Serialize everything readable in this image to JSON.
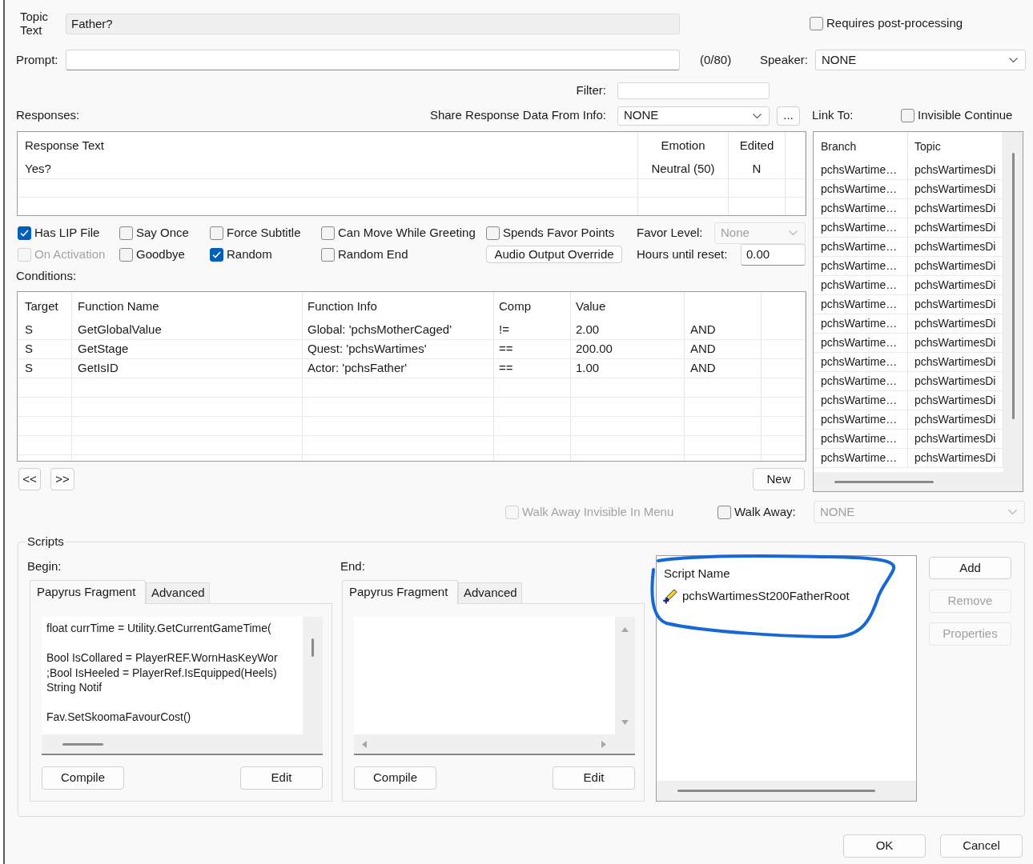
{
  "topic_text": {
    "label": "Topic Text",
    "value": "Father?"
  },
  "requires_post_processing": {
    "label": "Requires post-processing",
    "checked": false
  },
  "prompt": {
    "label": "Prompt:",
    "counter": "(0/80)"
  },
  "speaker": {
    "label": "Speaker:",
    "value": "NONE"
  },
  "filter": {
    "label": "Filter:"
  },
  "responses": {
    "label": "Responses:",
    "share_label": "Share Response Data From Info:",
    "share_value": "NONE",
    "more_button": "...",
    "columns": [
      "Response Text",
      "Emotion",
      "Edited"
    ],
    "rows": [
      [
        "Yes?",
        "Neutral (50)",
        "N"
      ]
    ]
  },
  "link_to": {
    "label": "Link To:",
    "invisible_continue": {
      "label": "Invisible Continue",
      "checked": false
    },
    "columns": [
      "Branch",
      "Topic"
    ],
    "rows": [
      [
        "pchsWartime…",
        "pchsWartimesDi"
      ],
      [
        "pchsWartime…",
        "pchsWartimesDi"
      ],
      [
        "pchsWartime…",
        "pchsWartimesDi"
      ],
      [
        "pchsWartime…",
        "pchsWartimesDi"
      ],
      [
        "pchsWartime…",
        "pchsWartimesDi"
      ],
      [
        "pchsWartime…",
        "pchsWartimesDi"
      ],
      [
        "pchsWartime…",
        "pchsWartimesDi"
      ],
      [
        "pchsWartime…",
        "pchsWartimesDi"
      ],
      [
        "pchsWartime…",
        "pchsWartimesDi"
      ],
      [
        "pchsWartime…",
        "pchsWartimesDi"
      ],
      [
        "pchsWartime…",
        "pchsWartimesDi"
      ],
      [
        "pchsWartime…",
        "pchsWartimesDi"
      ],
      [
        "pchsWartime…",
        "pchsWartimesDi"
      ],
      [
        "pchsWartime…",
        "pchsWartimesDi"
      ],
      [
        "pchsWartime…",
        "pchsWartimesDi"
      ],
      [
        "pchsWartime…",
        "pchsWartimesDi"
      ]
    ]
  },
  "options": [
    [
      {
        "kind": "checkbox",
        "label": "Has LIP File",
        "checked": true,
        "disabled": false
      },
      {
        "kind": "checkbox",
        "label": "Say Once",
        "checked": false,
        "disabled": false
      },
      {
        "kind": "checkbox",
        "label": "Force Subtitle",
        "checked": false,
        "disabled": false
      },
      {
        "kind": "checkbox",
        "label": "Can Move While Greeting",
        "checked": false,
        "disabled": false
      },
      {
        "kind": "checkbox",
        "label": "Spends Favor Points",
        "checked": false,
        "disabled": false
      },
      {
        "kind": "dropdown",
        "label": "Favor Level:",
        "value": "None",
        "disabled": true
      }
    ],
    [
      {
        "kind": "checkbox",
        "label": "On Activation",
        "checked": false,
        "disabled": true
      },
      {
        "kind": "checkbox",
        "label": "Goodbye",
        "checked": false,
        "disabled": false
      },
      {
        "kind": "checkbox",
        "label": "Random",
        "checked": true,
        "disabled": false
      },
      {
        "kind": "checkbox",
        "label": "Random End",
        "checked": false,
        "disabled": false
      },
      {
        "kind": "button",
        "label": "Audio Output Override",
        "disabled": false
      },
      {
        "kind": "field",
        "label": "Hours until reset:",
        "value": "0.00",
        "disabled": false
      }
    ]
  ],
  "conditions": {
    "label": "Conditions:",
    "columns": [
      "Target",
      "Function Name",
      "Function Info",
      "Comp",
      "Value"
    ],
    "rows": [
      [
        "S",
        "GetGlobalValue",
        "Global: 'pchsMotherCaged'",
        "!=",
        "2.00",
        "AND"
      ],
      [
        "S",
        "GetStage",
        "Quest: 'pchsWartimes'",
        "==",
        "200.00",
        "AND"
      ],
      [
        "S",
        "GetIsID",
        "Actor: 'pchsFather'",
        "==",
        "1.00",
        "AND"
      ]
    ]
  },
  "condition_nav": [
    "<<",
    ">>"
  ],
  "new_button": "New",
  "walk_away": [
    {
      "label": "Walk Away Invisible In Menu",
      "checked": false,
      "disabled": true
    },
    {
      "label": "Walk Away:",
      "checked": false,
      "disabled": false
    }
  ],
  "walk_away_target": {
    "value": "NONE",
    "disabled": true
  },
  "scripts": {
    "title": "Scripts",
    "fragments": [
      {
        "label": "Begin:",
        "tabs": [
          {
            "label": "Papyrus Fragment",
            "selected": true
          },
          {
            "label": "Advanced",
            "selected": false
          }
        ],
        "code": [
          [
            "float currTime = Utility.GetCurrentGameTime("
          ],
          [
            "Bool IsCollared = PlayerREF.WornHasKeyWor",
            ";Bool IsHeeled = PlayerRef.IsEquipped(Heels)",
            "String Notif"
          ],
          [
            "Fav.SetSkoomaFavourCost()"
          ]
        ],
        "buttons": [
          "Compile",
          "Edit"
        ]
      },
      {
        "label": "End:",
        "tabs": [
          {
            "label": "Papyrus Fragment",
            "selected": true
          },
          {
            "label": "Advanced",
            "selected": false
          }
        ],
        "buttons": [
          "Compile",
          "Edit"
        ]
      }
    ],
    "script_list": {
      "column": "Script Name",
      "rows": [
        {
          "name": "pchsWartimesSt200FatherRoot"
        }
      ]
    },
    "buttons": [
      {
        "label": "Add",
        "disabled": false
      },
      {
        "label": "Remove",
        "disabled": true
      },
      {
        "label": "Properties",
        "disabled": true
      }
    ]
  },
  "dialog_buttons": [
    "OK",
    "Cancel"
  ]
}
